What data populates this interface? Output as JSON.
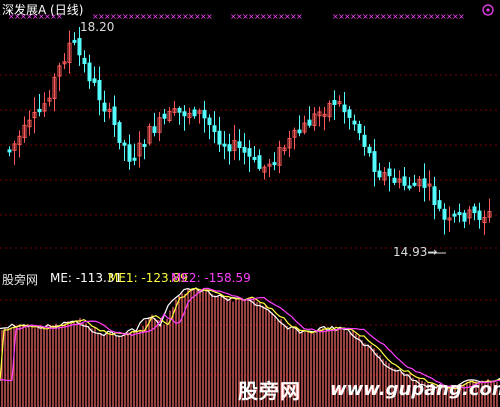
{
  "header": {
    "title": "深发展A (日线)",
    "price_high_label": "18.20",
    "price_low_label": "14.93",
    "low_arrow": "→"
  },
  "indicator": {
    "name": "股旁网",
    "me_label": "ME: -113.31",
    "me1_label": "ME1: -123.89",
    "me2_label": "ME2: -158.59"
  },
  "watermark": {
    "text": "股旁网",
    "url": "www.gupang.com"
  },
  "colors": {
    "background": "#000000",
    "up": "#ff5a5a",
    "down": "#54ffff",
    "grid": "#7a0000",
    "me": "#ffffff",
    "me1": "#ffff40",
    "me2": "#ff40ff",
    "marker": "#ff40ff"
  },
  "icons": [
    "compass-icon"
  ]
}
